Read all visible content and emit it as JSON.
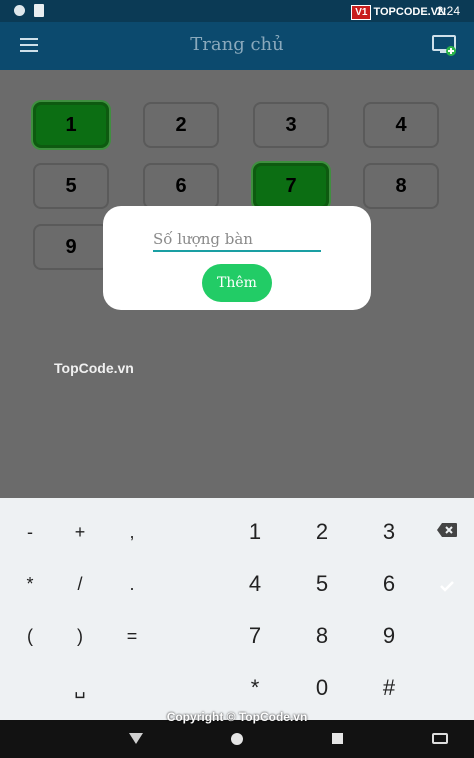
{
  "status_bar": {
    "time": "2:24",
    "watermark_logo_box": "V1",
    "watermark_logo_text": "TOPCODE.VN"
  },
  "app_bar": {
    "title": "Trang chủ",
    "menu_icon": "hamburger-menu-icon",
    "action_icon": "add-screen-icon"
  },
  "tables": [
    {
      "label": "1",
      "selected": true
    },
    {
      "label": "2",
      "selected": false
    },
    {
      "label": "3",
      "selected": false
    },
    {
      "label": "4",
      "selected": false
    },
    {
      "label": "5",
      "selected": false
    },
    {
      "label": "6",
      "selected": false
    },
    {
      "label": "7",
      "selected": true
    },
    {
      "label": "8",
      "selected": false
    },
    {
      "label": "9",
      "selected": false
    }
  ],
  "dialog": {
    "input_placeholder": "Số lượng bàn",
    "input_value": "",
    "add_button": "Thêm"
  },
  "watermark": "TopCode.vn",
  "keyboard": {
    "rows": [
      [
        "-",
        "+",
        ",",
        "1",
        "2",
        "3"
      ],
      [
        "*",
        "/",
        ".",
        "4",
        "5",
        "6"
      ],
      [
        "(",
        ")",
        "=",
        "7",
        "8",
        "9"
      ],
      [
        "␣",
        "*",
        "0",
        "#"
      ]
    ]
  },
  "copyright": "Copyright © TopCode.vn",
  "colors": {
    "app_bar": "#0c4a6e",
    "selected_table": "#0c6e13",
    "add_button": "#22cc66",
    "done_key": "#2bb3a8"
  }
}
